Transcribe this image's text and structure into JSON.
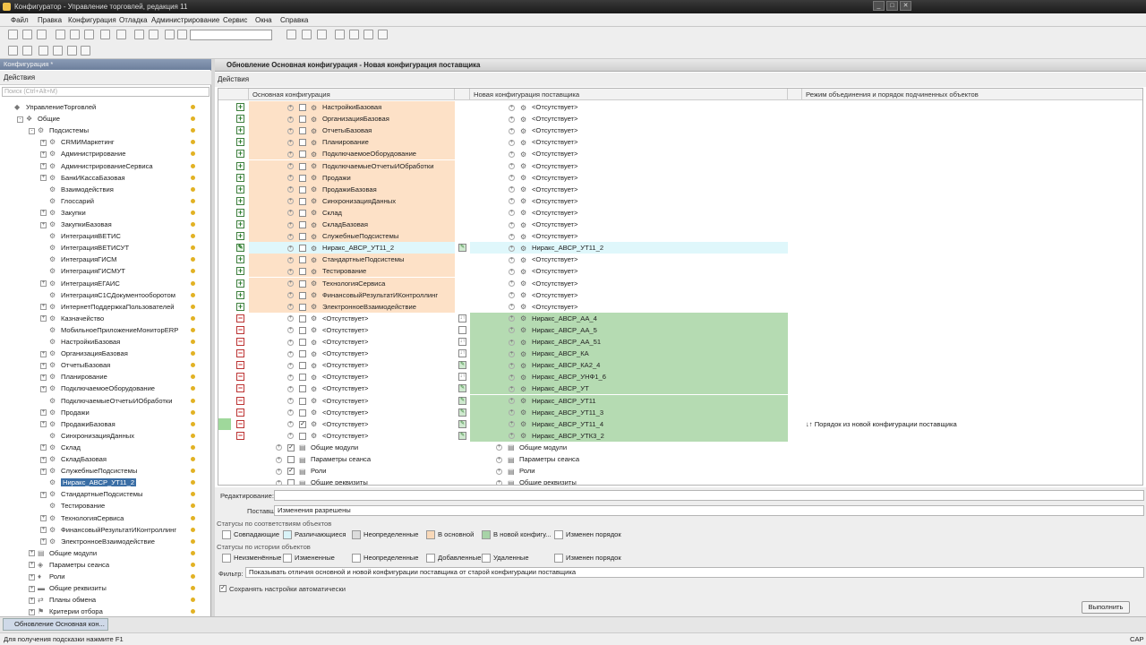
{
  "window": {
    "title": "Конфигуратор - Управление торговлей, редакция 11"
  },
  "menu": [
    "Файл",
    "Правка",
    "Конфигурация",
    "Отладка",
    "Администрирование",
    "Сервис",
    "Окна",
    "Справка"
  ],
  "left_panel": {
    "header": "Конфигурация *",
    "actions_label": "Действия",
    "search_placeholder": "Поиск (Ctrl+Alt+M)",
    "nodes": [
      {
        "label": "УправлениеТорговлей",
        "level": 0,
        "icon": "config-icon",
        "exp": "",
        "dot": true
      },
      {
        "label": "Общие",
        "level": 1,
        "icon": "common-icon",
        "exp": "-",
        "dot": true
      },
      {
        "label": "Подсистемы",
        "level": 2,
        "icon": "subsystem-icon",
        "exp": "-",
        "dot": true
      },
      {
        "label": "CRMИМаркетинг",
        "level": 3,
        "icon": "subsystem-icon",
        "exp": "+",
        "dot": true
      },
      {
        "label": "Администрирование",
        "level": 3,
        "icon": "subsystem-icon",
        "exp": "+",
        "dot": true
      },
      {
        "label": "АдминистрированиеСервиса",
        "level": 3,
        "icon": "subsystem-icon",
        "exp": "+",
        "dot": true
      },
      {
        "label": "БанкИКассаБазовая",
        "level": 3,
        "icon": "subsystem-icon",
        "exp": "+",
        "dot": true
      },
      {
        "label": "Взаимодействия",
        "level": 3,
        "icon": "subsystem-icon",
        "exp": "",
        "dot": true
      },
      {
        "label": "Глоссарий",
        "level": 3,
        "icon": "subsystem-icon",
        "exp": "",
        "dot": true
      },
      {
        "label": "Закупки",
        "level": 3,
        "icon": "subsystem-icon",
        "exp": "+",
        "dot": true
      },
      {
        "label": "ЗакупкиБазовая",
        "level": 3,
        "icon": "subsystem-icon",
        "exp": "+",
        "dot": true
      },
      {
        "label": "ИнтеграцияВЕТИС",
        "level": 3,
        "icon": "subsystem-icon",
        "exp": "",
        "dot": true
      },
      {
        "label": "ИнтеграцияВЕТИСУТ",
        "level": 3,
        "icon": "subsystem-icon",
        "exp": "",
        "dot": true
      },
      {
        "label": "ИнтеграцияГИСМ",
        "level": 3,
        "icon": "subsystem-icon",
        "exp": "",
        "dot": true
      },
      {
        "label": "ИнтеграцияГИСМУТ",
        "level": 3,
        "icon": "subsystem-icon",
        "exp": "",
        "dot": true
      },
      {
        "label": "ИнтеграцияЕГАИС",
        "level": 3,
        "icon": "subsystem-icon",
        "exp": "+",
        "dot": true
      },
      {
        "label": "ИнтеграцияС1СДокументооборотом",
        "level": 3,
        "icon": "subsystem-icon",
        "exp": "",
        "dot": true
      },
      {
        "label": "ИнтернетПоддержкаПользователей",
        "level": 3,
        "icon": "subsystem-icon",
        "exp": "+",
        "dot": true
      },
      {
        "label": "Казначейство",
        "level": 3,
        "icon": "subsystem-icon",
        "exp": "+",
        "dot": true
      },
      {
        "label": "МобильноеПриложениеМониторERP",
        "level": 3,
        "icon": "subsystem-icon",
        "exp": "",
        "dot": true
      },
      {
        "label": "НастройкиБазовая",
        "level": 3,
        "icon": "subsystem-icon",
        "exp": "",
        "dot": true
      },
      {
        "label": "ОрганизацияБазовая",
        "level": 3,
        "icon": "subsystem-icon",
        "exp": "+",
        "dot": true
      },
      {
        "label": "ОтчетыБазовая",
        "level": 3,
        "icon": "subsystem-icon",
        "exp": "+",
        "dot": true
      },
      {
        "label": "Планирование",
        "level": 3,
        "icon": "subsystem-icon",
        "exp": "+",
        "dot": true
      },
      {
        "label": "ПодключаемоеОборудование",
        "level": 3,
        "icon": "subsystem-icon",
        "exp": "+",
        "dot": true
      },
      {
        "label": "ПодключаемыеОтчетыИОбработки",
        "level": 3,
        "icon": "subsystem-icon",
        "exp": "",
        "dot": true
      },
      {
        "label": "Продажи",
        "level": 3,
        "icon": "subsystem-icon",
        "exp": "+",
        "dot": true
      },
      {
        "label": "ПродажиБазовая",
        "level": 3,
        "icon": "subsystem-icon",
        "exp": "+",
        "dot": true
      },
      {
        "label": "СинхронизацияДанных",
        "level": 3,
        "icon": "subsystem-icon",
        "exp": "",
        "dot": true
      },
      {
        "label": "Склад",
        "level": 3,
        "icon": "subsystem-icon",
        "exp": "+",
        "dot": true
      },
      {
        "label": "СкладБазовая",
        "level": 3,
        "icon": "subsystem-icon",
        "exp": "+",
        "dot": true
      },
      {
        "label": "СлужебныеПодсистемы",
        "level": 3,
        "icon": "subsystem-icon",
        "exp": "+",
        "dot": true
      },
      {
        "label": "Ниракс_АВСР_УТ11_2",
        "level": 3,
        "icon": "subsystem-icon",
        "exp": "",
        "dot": true,
        "selected": true
      },
      {
        "label": "СтандартныеПодсистемы",
        "level": 3,
        "icon": "subsystem-icon",
        "exp": "+",
        "dot": true
      },
      {
        "label": "Тестирование",
        "level": 3,
        "icon": "subsystem-icon",
        "exp": "",
        "dot": true
      },
      {
        "label": "ТехнологияСервиса",
        "level": 3,
        "icon": "subsystem-icon",
        "exp": "+",
        "dot": true
      },
      {
        "label": "ФинансовыйРезультатИКонтроллинг",
        "level": 3,
        "icon": "subsystem-icon",
        "exp": "+",
        "dot": true
      },
      {
        "label": "ЭлектронноеВзаимодействие",
        "level": 3,
        "icon": "subsystem-icon",
        "exp": "+",
        "dot": true
      },
      {
        "label": "Общие модули",
        "level": 2,
        "icon": "module-icon",
        "exp": "+",
        "dot": true
      },
      {
        "label": "Параметры сеанса",
        "level": 2,
        "icon": "param-icon",
        "exp": "+",
        "dot": true
      },
      {
        "label": "Роли",
        "level": 2,
        "icon": "role-icon",
        "exp": "+",
        "dot": true
      },
      {
        "label": "Общие реквизиты",
        "level": 2,
        "icon": "attr-icon",
        "exp": "+",
        "dot": true
      },
      {
        "label": "Планы обмена",
        "level": 2,
        "icon": "exchange-icon",
        "exp": "+",
        "dot": true
      },
      {
        "label": "Критерии отбора",
        "level": 2,
        "icon": "filter-icon",
        "exp": "+",
        "dot": true
      }
    ]
  },
  "main": {
    "title": "Обновление Основная конфигурация - Новая конфигурация поставщика",
    "actions_label": "Действия",
    "columns": [
      "Основная конфигурация",
      "Новая конфигурация поставщика",
      "Режим объединения и порядок подчиненных объектов"
    ],
    "rows": [
      {
        "left": "НастройкиБазовая",
        "right": "<Отсутствует>",
        "status": "plus",
        "bg": "orange"
      },
      {
        "left": "ОрганизацияБазовая",
        "right": "<Отсутствует>",
        "status": "plus",
        "bg": "orange"
      },
      {
        "left": "ОтчетыБазовая",
        "right": "<Отсутствует>",
        "status": "plus",
        "bg": "orange"
      },
      {
        "left": "Планирование",
        "right": "<Отсутствует>",
        "status": "plus",
        "bg": "orange"
      },
      {
        "left": "ПодключаемоеОборудование",
        "right": "<Отсутствует>",
        "status": "plus",
        "bg": "orange"
      },
      {
        "left": "ПодключаемыеОтчетыИОбработки",
        "right": "<Отсутствует>",
        "status": "plus",
        "bg": "orange"
      },
      {
        "left": "Продажи",
        "right": "<Отсутствует>",
        "status": "plus",
        "bg": "orange"
      },
      {
        "left": "ПродажиБазовая",
        "right": "<Отсутствует>",
        "status": "plus",
        "bg": "orange"
      },
      {
        "left": "СинхронизацияДанных",
        "right": "<Отсутствует>",
        "status": "plus",
        "bg": "orange"
      },
      {
        "left": "Склад",
        "right": "<Отсутствует>",
        "status": "plus",
        "bg": "orange"
      },
      {
        "left": "СкладБазовая",
        "right": "<Отсутствует>",
        "status": "plus",
        "bg": "orange"
      },
      {
        "left": "СлужебныеПодсистемы",
        "right": "<Отсутствует>",
        "status": "plus",
        "bg": "orange"
      },
      {
        "left": "Ниракс_АВСР_УТ11_2",
        "right": "Ниракс_АВСР_УТ11_2",
        "status": "edit",
        "bg": "cyan",
        "mark": "edit"
      },
      {
        "left": "СтандартныеПодсистемы",
        "right": "<Отсутствует>",
        "status": "plus",
        "bg": "orange"
      },
      {
        "left": "Тестирование",
        "right": "<Отсутствует>",
        "status": "plus",
        "bg": "orange"
      },
      {
        "left": "ТехнологияСервиса",
        "right": "<Отсутствует>",
        "status": "plus",
        "bg": "orange"
      },
      {
        "left": "ФинансовыйРезультатИКонтроллинг",
        "right": "<Отсутствует>",
        "status": "plus",
        "bg": "orange"
      },
      {
        "left": "ЭлектронноеВзаимодействие",
        "right": "<Отсутствует>",
        "status": "plus",
        "bg": "orange"
      },
      {
        "left": "<Отсутствует>",
        "right": "Ниракс_АВСР_АА_4",
        "status": "minus",
        "bg": "green",
        "mark": "order"
      },
      {
        "left": "<Отсутствует>",
        "right": "Ниракс_АВСР_АА_5",
        "status": "minus",
        "bg": "green",
        "mark": "blank"
      },
      {
        "left": "<Отсутствует>",
        "right": "Ниракс_АВСР_АА_51",
        "status": "minus",
        "bg": "green",
        "mark": "order"
      },
      {
        "left": "<Отсутствует>",
        "right": "Ниракс_АВСР_КА",
        "status": "minus",
        "bg": "green",
        "mark": "order"
      },
      {
        "left": "<Отсутствует>",
        "right": "Ниракс_АВСР_КА2_4",
        "status": "minus",
        "bg": "green",
        "mark": "edit"
      },
      {
        "left": "<Отсутствует>",
        "right": "Ниракс_АВСР_УНФ1_6",
        "status": "minus",
        "bg": "green",
        "mark": "order"
      },
      {
        "left": "<Отсутствует>",
        "right": "Ниракс_АВСР_УТ",
        "status": "minus",
        "bg": "green",
        "mark": "edit"
      },
      {
        "left": "<Отсутствует>",
        "right": "Ниракс_АВСР_УТ11",
        "status": "minus",
        "bg": "green",
        "mark": "edit"
      },
      {
        "left": "<Отсутствует>",
        "right": "Ниракс_АВСР_УТ11_3",
        "status": "minus",
        "bg": "green",
        "mark": "edit"
      },
      {
        "left": "<Отсутствует>",
        "right": "Ниракс_АВСР_УТ11_4",
        "status": "minus",
        "bg": "green",
        "mark": "edit",
        "checked": true,
        "mode": "↓↑ Порядок из новой конфигурации поставщика"
      },
      {
        "left": "<Отсутствует>",
        "right": "Ниракс_АВСР_УТК3_2",
        "status": "minus",
        "bg": "green",
        "mark": "edit"
      },
      {
        "left": "Общие модули",
        "right": "Общие модули",
        "status": "none",
        "bg": "white",
        "group": true,
        "checked": true
      },
      {
        "left": "Параметры сеанса",
        "right": "Параметры сеанса",
        "status": "none",
        "bg": "white",
        "group": true
      },
      {
        "left": "Роли",
        "right": "Роли",
        "status": "none",
        "bg": "white",
        "group": true,
        "checked": true
      },
      {
        "left": "Общие реквизиты",
        "right": "Общие реквизиты",
        "status": "none",
        "bg": "white",
        "group": true
      }
    ]
  },
  "form": {
    "edit_label": "Редактирование:",
    "supply_label": "Поставщик:",
    "supply_value": "Изменения разрешены",
    "status_obj_title": "Статусы по соответствиям объектов",
    "status_obj": [
      {
        "label": "Совпадающие",
        "color": "#ffffff"
      },
      {
        "label": "Различающиеся",
        "color": "#d9f3f8"
      },
      {
        "label": "Неопределенные",
        "color": "#dcdcdc"
      },
      {
        "label": "В основной",
        "color": "#f8d8b8"
      },
      {
        "label": "В новой конфигу...",
        "color": "#a7d3a7"
      },
      {
        "label": "Изменен порядок",
        "color": "#ffffff"
      }
    ],
    "status_hist_title": "Статусы по истории объектов",
    "status_hist": [
      {
        "label": "Неизменённые"
      },
      {
        "label": "Измененные"
      },
      {
        "label": "Неопределенные"
      },
      {
        "label": "Добавленные"
      },
      {
        "label": "Удаленные"
      },
      {
        "label": "Изменен порядок"
      }
    ],
    "filter_label": "Фильтр:",
    "filter_value": "Показывать отличия основной и новой конфигурации поставщика от старой конфигурации поставщика",
    "autosave_label": "Сохранять настройки автоматически",
    "run_button": "Выполнить"
  },
  "taskbar": {
    "item": "Обновление Основная кон..."
  },
  "statusbar": {
    "hint": "Для получения подсказки нажмите F1",
    "cap": "CAP"
  },
  "colors": {
    "orange": "#fde1c7",
    "green": "#b5dbb2",
    "cyan": "#dff7fb",
    "accent": "#3a6ea5"
  }
}
